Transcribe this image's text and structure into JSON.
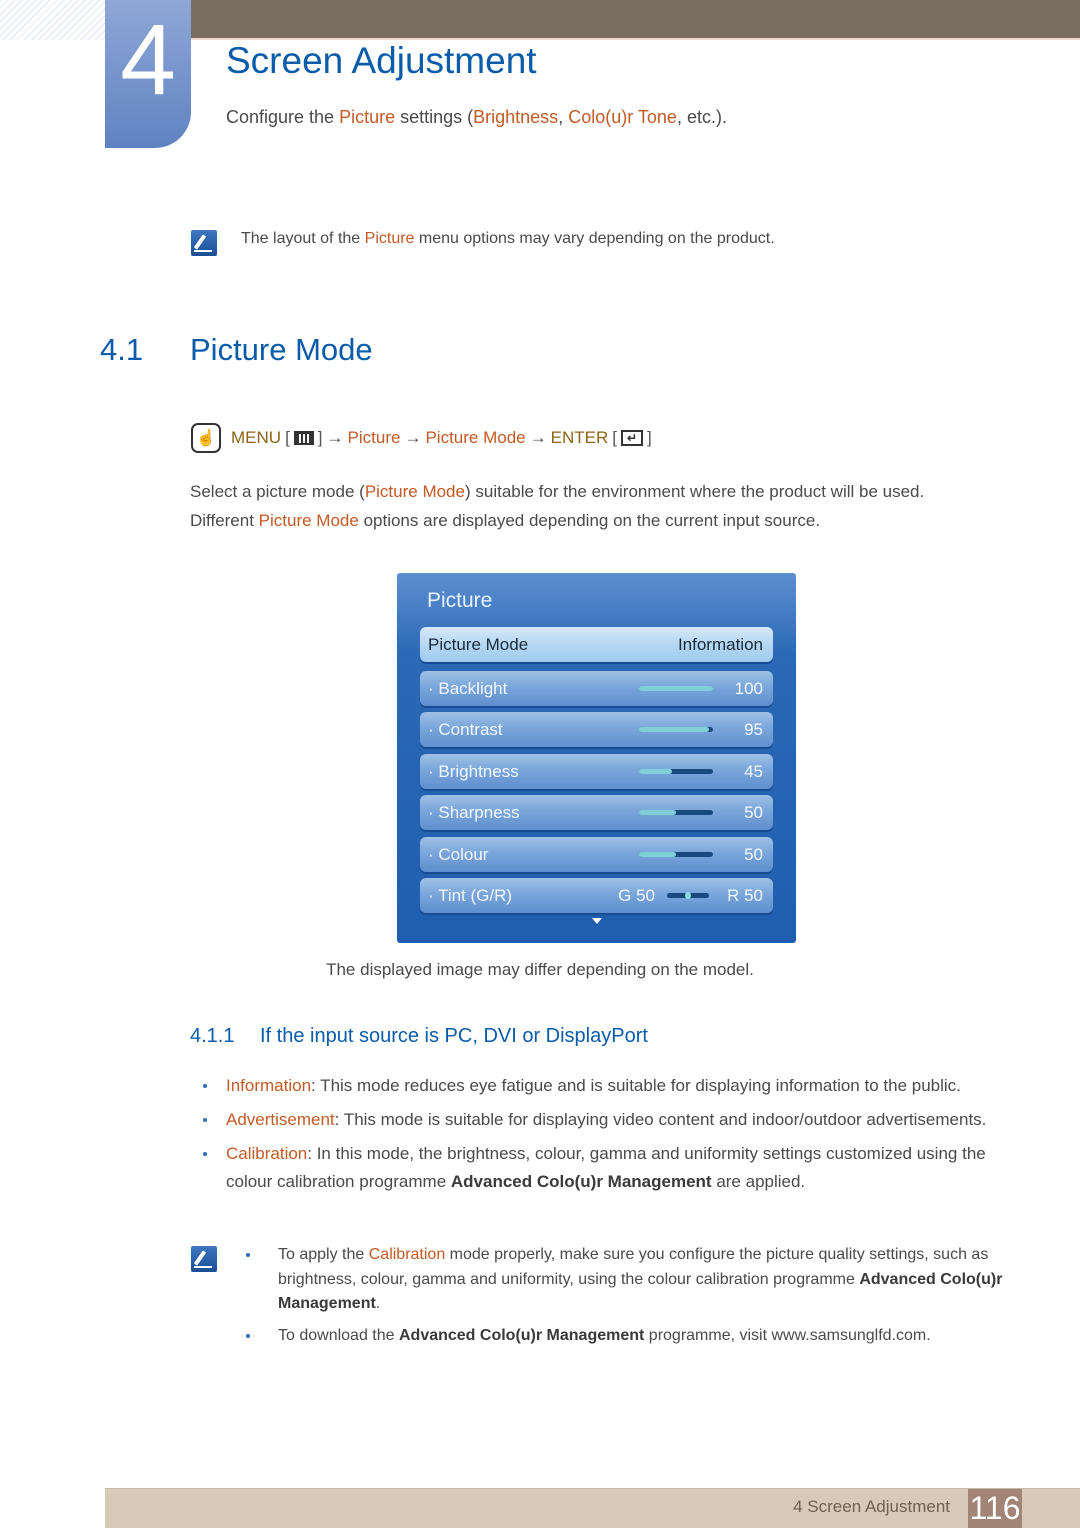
{
  "header": {
    "chapter_number": "4",
    "chapter_title": "Screen Adjustment",
    "subtitle_parts": [
      {
        "text": "Configure the ",
        "style": "plain"
      },
      {
        "text": "Picture",
        "style": "orange"
      },
      {
        "text": " settings (",
        "style": "plain"
      },
      {
        "text": "Brightness",
        "style": "orange"
      },
      {
        "text": ", ",
        "style": "plain"
      },
      {
        "text": "Colo(u)r Tone",
        "style": "orange"
      },
      {
        "text": ", etc.).",
        "style": "plain"
      }
    ]
  },
  "top_note": {
    "icon": "note-pencil-icon",
    "parts": [
      {
        "text": "The layout of the ",
        "style": "plain"
      },
      {
        "text": "Picture",
        "style": "orange"
      },
      {
        "text": " menu options may vary depending on the product.",
        "style": "plain"
      }
    ]
  },
  "section": {
    "number": "4.1",
    "title": "Picture Mode"
  },
  "menu_path": {
    "icon": "hand-remote-icon",
    "menu_label": "MENU",
    "menu_icon": "menu-grid-icon",
    "arrow": "→",
    "step1": "Picture",
    "step2": "Picture Mode",
    "enter_label": "ENTER",
    "enter_icon": "enter-return-icon",
    "enter_glyph": "↵"
  },
  "intro_paragraph": {
    "line1": [
      {
        "text": "Select a picture mode (",
        "style": "plain"
      },
      {
        "text": "Picture Mode",
        "style": "orange"
      },
      {
        "text": ") suitable for the environment where the product will be used.",
        "style": "plain"
      }
    ],
    "line2": [
      {
        "text": "Different ",
        "style": "plain"
      },
      {
        "text": "Picture Mode",
        "style": "orange"
      },
      {
        "text": " options are displayed depending on the current input source.",
        "style": "plain"
      }
    ]
  },
  "osd": {
    "title": "Picture",
    "selected_row": {
      "label": "Picture Mode",
      "value": "Information"
    },
    "rows": [
      {
        "label": "· Backlight",
        "value": "100",
        "percent": 100
      },
      {
        "label": "· Contrast",
        "value": "95",
        "percent": 95
      },
      {
        "label": "· Brightness",
        "value": "45",
        "percent": 45
      },
      {
        "label": "· Sharpness",
        "value": "50",
        "percent": 50
      },
      {
        "label": "· Colour",
        "value": "50",
        "percent": 50
      }
    ],
    "tint": {
      "label": "· Tint (G/R)",
      "g_value": "G 50",
      "r_value": "R 50",
      "percent": 50
    },
    "more_icon": "down-arrow-icon"
  },
  "caption": "The displayed image may differ depending on the model.",
  "subsection": {
    "number": "4.1.1",
    "title": "If the input source is PC, DVI or DisplayPort"
  },
  "modes": [
    {
      "name": "Information",
      "text": ": This mode reduces eye fatigue and is suitable for displaying information to the public."
    },
    {
      "name": "Advertisement",
      "text": ": This mode is suitable for displaying video content and indoor/outdoor advertisements."
    },
    {
      "name": "Calibration",
      "text_before": ": In this mode, the brightness, colour, gamma and uniformity settings customized using the colour calibration programme ",
      "bold": "Advanced Colo(u)r Management",
      "text_after": " are applied."
    }
  ],
  "bottom_notes": [
    {
      "before": "To apply the ",
      "orange": "Calibration",
      "middle": " mode properly, make sure you configure the picture quality settings, such as brightness, colour, gamma and uniformity, using the colour calibration programme ",
      "bold": "Advanced Colo(u)r Management",
      "after": "."
    },
    {
      "before": "To download the ",
      "bold": "Advanced Colo(u)r Management",
      "after": " programme, visit www.samsunglfd.com."
    }
  ],
  "footer": {
    "chapter_label": "4 Screen Adjustment",
    "page_number": "116"
  },
  "colors": {
    "heading_blue": "#0a5cab",
    "highlight_orange": "#c45a24",
    "menu_olive": "#8a6414",
    "topbar_brown": "#7a6e62",
    "footer_tan": "#d8cab8",
    "page_badge": "#a28576",
    "osd_blue": "#1f5eaf"
  }
}
